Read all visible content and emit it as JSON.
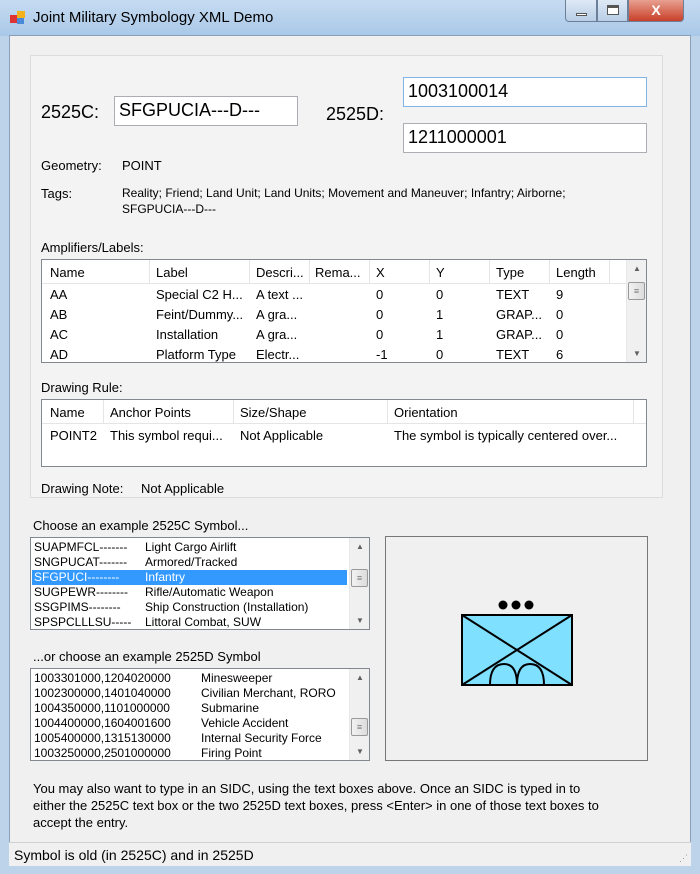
{
  "window": {
    "title": "Joint Military Symbology XML Demo",
    "minimize": "minimize",
    "maximize": "maximize",
    "close": "X"
  },
  "sidc": {
    "c_label": "2525C:",
    "c_value": "SFGPUCIA---D---",
    "d_label": "2525D:",
    "d_value1": "1003100014",
    "d_value2": "1211000001"
  },
  "geometry": {
    "label": "Geometry:",
    "value": "POINT"
  },
  "tags": {
    "label": "Tags:",
    "line1": "Reality; Friend; Land Unit; Land Units; Movement and Maneuver; Infantry; Airborne;",
    "line2": "SFGPUCIA---D---"
  },
  "amplifiers": {
    "label": "Amplifiers/Labels:",
    "columns": [
      "Name",
      "Label",
      "Descri...",
      "Rema...",
      "X",
      "Y",
      "Type",
      "Length"
    ],
    "rows": [
      [
        "AA",
        "Special C2 H...",
        "A text ...",
        "",
        "0",
        "0",
        "TEXT",
        "9"
      ],
      [
        "AB",
        "Feint/Dummy...",
        "A gra...",
        "",
        "0",
        "1",
        "GRAP...",
        "0"
      ],
      [
        "AC",
        "Installation",
        "A gra...",
        "",
        "0",
        "1",
        "GRAP...",
        "0"
      ],
      [
        "AD",
        "Platform Type",
        "Electr...",
        "",
        "-1",
        "0",
        "TEXT",
        "6"
      ]
    ]
  },
  "drawing_rule": {
    "label": "Drawing Rule:",
    "columns": [
      "Name",
      "Anchor Points",
      "Size/Shape",
      "Orientation"
    ],
    "rows": [
      [
        "POINT2",
        "This symbol requi...",
        "Not Applicable",
        "The symbol is typically centered over..."
      ]
    ]
  },
  "drawing_note": {
    "label": "Drawing Note:",
    "value": "Not Applicable"
  },
  "list_c": {
    "label": "Choose an example 2525C Symbol...",
    "selected_index": 2,
    "items": [
      [
        "SUAPMFCL-------",
        "Light Cargo Airlift"
      ],
      [
        "SNGPUCAT-------",
        "Armored/Tracked"
      ],
      [
        "SFGPUCI--------",
        "Infantry"
      ],
      [
        "SUGPEWR--------",
        "Rifle/Automatic Weapon"
      ],
      [
        "SSGPIMS--------",
        "Ship Construction (Installation)"
      ],
      [
        "SPSPCLLLSU-----",
        "Littoral Combat, SUW"
      ]
    ]
  },
  "list_d": {
    "label": "...or choose an example 2525D Symbol",
    "items": [
      [
        "1003301000,1204020000",
        "Minesweeper"
      ],
      [
        "1002300000,1401040000",
        "Civilian Merchant, RORO"
      ],
      [
        "1004350000,1101000000",
        "Submarine"
      ],
      [
        "1004400000,1604001600",
        "Vehicle Accident"
      ],
      [
        "1005400000,1315130000",
        "Internal Security Force"
      ],
      [
        "1003250000,2501000000",
        "Firing Point"
      ]
    ]
  },
  "symbol": {
    "fill": "#80e0ff",
    "frame": "#000000",
    "icon": "infantry-airborne"
  },
  "help": {
    "line1": "You may also want to type in an SIDC, using the text boxes above.  Once an SIDC is typed in to",
    "line2": "either the 2525C text box or the two 2525D text boxes, press <Enter> in one of those text boxes to",
    "line3": "accept the entry."
  },
  "status": {
    "text": "Symbol is old (in 2525C) and in 2525D"
  }
}
